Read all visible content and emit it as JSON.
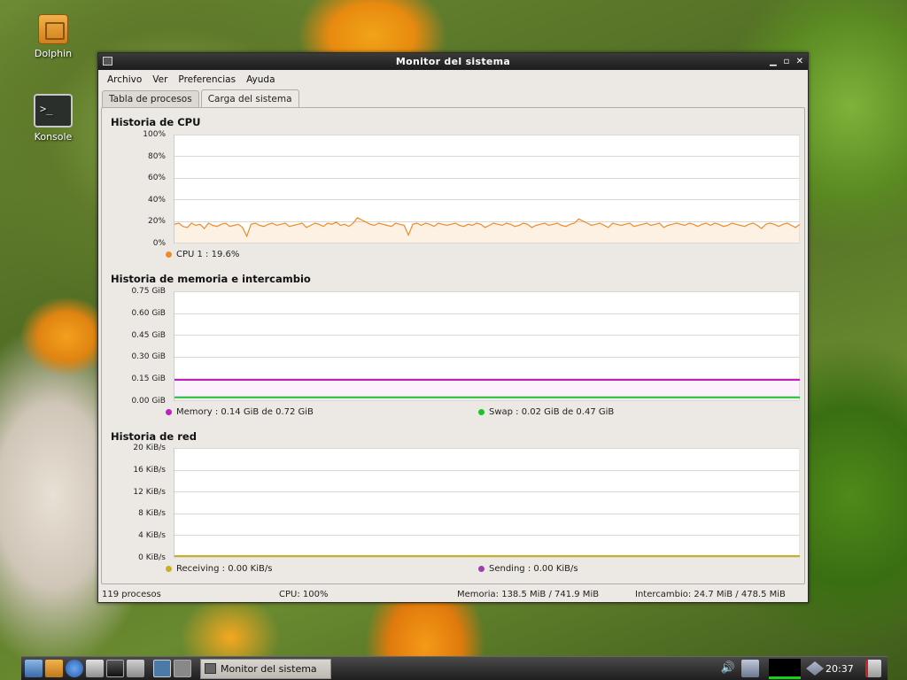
{
  "desktop": {
    "icons": [
      {
        "label": "Dolphin"
      },
      {
        "label": "Konsole"
      }
    ]
  },
  "window": {
    "title": "Monitor del sistema",
    "controls": {
      "minimize": "▁",
      "maximize": "▫",
      "close": "✕"
    }
  },
  "menu": [
    "Archivo",
    "Ver",
    "Preferencias",
    "Ayuda"
  ],
  "tabs": [
    {
      "label": "Tabla de procesos",
      "active": false
    },
    {
      "label": "Carga del sistema",
      "active": true
    }
  ],
  "cpu": {
    "title": "Historia de CPU",
    "y_labels": [
      "100%",
      "80%",
      "60%",
      "40%",
      "20%",
      "0%"
    ],
    "legend": "CPU 1 : 19.6%",
    "color": "#f08a24",
    "values": [
      17,
      18,
      15,
      14,
      18,
      16,
      17,
      13,
      18,
      16,
      15,
      17,
      18,
      15,
      16,
      17,
      14,
      6,
      17,
      18,
      16,
      15,
      17,
      18,
      16,
      17,
      18,
      15,
      16,
      17,
      18,
      14,
      16,
      18,
      17,
      15,
      18,
      17,
      19,
      16,
      17,
      15,
      18,
      23,
      21,
      19,
      17,
      16,
      18,
      17,
      16,
      15,
      18,
      17,
      16,
      7,
      17,
      18,
      16,
      18,
      17,
      15,
      18,
      17,
      16,
      17,
      18,
      16,
      15,
      17,
      16,
      18,
      17,
      14,
      16,
      18,
      17,
      16,
      18,
      17,
      15,
      16,
      18,
      17,
      14,
      16,
      17,
      18,
      16,
      17,
      18,
      16,
      15,
      17,
      18,
      22,
      20,
      18,
      16,
      17,
      18,
      16,
      14,
      18,
      17,
      16,
      17,
      18,
      15,
      16,
      17,
      18,
      16,
      17,
      18,
      14,
      16,
      17,
      18,
      17,
      16,
      18,
      17,
      15,
      17,
      18,
      16,
      18,
      17,
      15,
      16,
      18,
      17,
      16,
      15,
      17,
      18,
      16,
      13,
      17,
      18,
      17,
      15,
      17,
      18,
      16,
      14,
      17
    ]
  },
  "memory": {
    "title": "Historia de memoria e intercambio",
    "y_labels": [
      "0.75 GiB",
      "0.60 GiB",
      "0.45 GiB",
      "0.30 GiB",
      "0.15 GiB",
      "0.00 GiB"
    ],
    "ymax": 0.75,
    "memory_value": 0.14,
    "swap_value": 0.02,
    "memory_legend": "Memory : 0.14 GiB de 0.72 GiB",
    "swap_legend": "Swap : 0.02 GiB de 0.47 GiB",
    "memory_color": "#c020c0",
    "swap_color": "#20c030"
  },
  "network": {
    "title": "Historia de red",
    "y_labels": [
      "20 KiB/s",
      "16 KiB/s",
      "12 KiB/s",
      "8 KiB/s",
      "4 KiB/s",
      "0 KiB/s"
    ],
    "receiving_legend": "Receiving : 0.00 KiB/s",
    "sending_legend": "Sending : 0.00 KiB/s",
    "receiving_color": "#c8b020",
    "sending_color": "#9a40b0"
  },
  "status": {
    "processes": "119 procesos",
    "cpu": "CPU: 100%",
    "memory": "Memoria: 138.5 MiB / 741.9 MiB",
    "swap": "Intercambio: 24.7 MiB / 478.5 MiB"
  },
  "taskbar": {
    "task_label": "Monitor del sistema",
    "clock": "20:37"
  }
}
